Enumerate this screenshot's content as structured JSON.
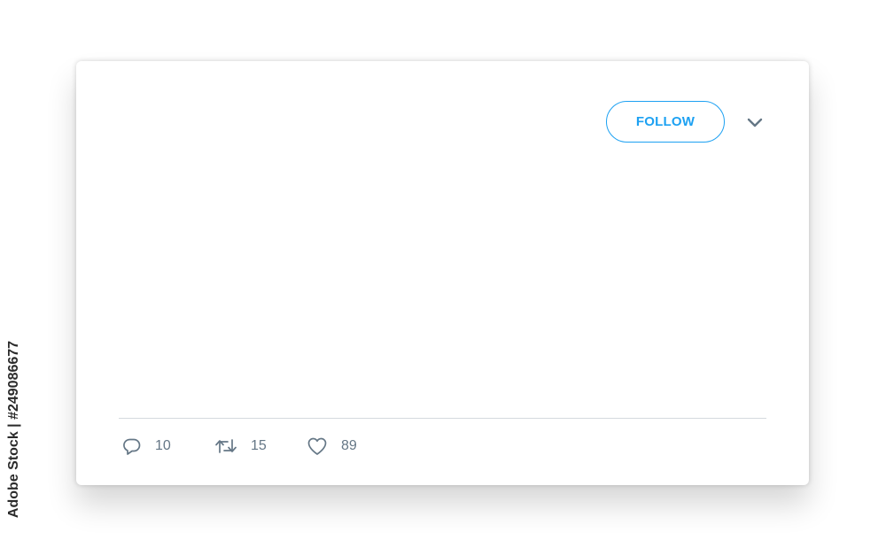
{
  "tweet": {
    "follow_label": "FOLLOW",
    "menu_icon": "chevron-down-icon",
    "actions": {
      "reply": {
        "icon": "reply-icon",
        "count": "10"
      },
      "retweet": {
        "icon": "retweet-icon",
        "count": "15"
      },
      "like": {
        "icon": "heart-icon",
        "count": "89"
      }
    }
  },
  "watermark": {
    "text": "Adobe Stock | #249086677"
  },
  "colors": {
    "accent": "#1da1f2",
    "icon_gray": "#657786",
    "divider": "#d4d9de"
  }
}
